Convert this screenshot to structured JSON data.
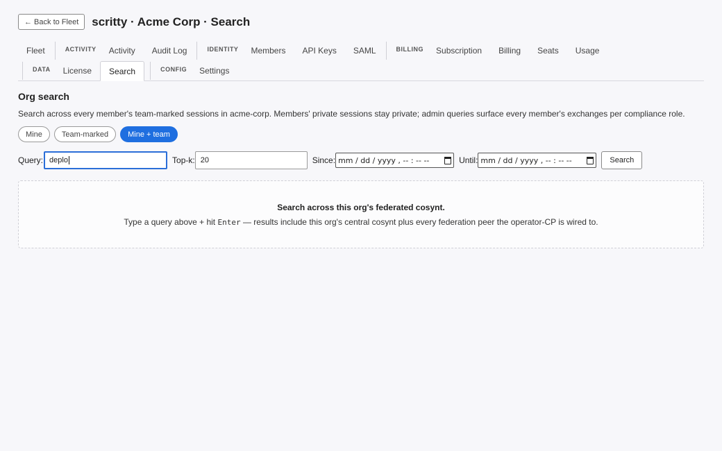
{
  "header": {
    "back_label": "← Back to Fleet",
    "title": "scritty · Acme Corp · Search"
  },
  "nav": {
    "row1": {
      "fleet": "Fleet",
      "activity_group": "ACTIVITY",
      "activity": "Activity",
      "audit_log": "Audit Log",
      "identity_group": "IDENTITY",
      "members": "Members",
      "api_keys": "API Keys",
      "saml": "SAML",
      "billing_group": "BILLING",
      "subscription": "Subscription",
      "billing": "Billing",
      "seats": "Seats",
      "usage": "Usage"
    },
    "row2": {
      "data_group": "DATA",
      "license": "License",
      "search": "Search",
      "config_group": "CONFIG",
      "settings": "Settings"
    },
    "active_tab": "Search"
  },
  "section": {
    "title": "Org search",
    "description": "Search across every member's team-marked sessions in acme-corp. Members' private sessions stay private; admin queries surface every member's exchanges per compliance role."
  },
  "scope": {
    "options": [
      "Mine",
      "Team-marked",
      "Mine + team"
    ],
    "selected": "Mine + team"
  },
  "query_form": {
    "query_label": "Query:",
    "query_value": "deplo",
    "topk_label": "Top-k:",
    "topk_value": "20",
    "since_label": "Since:",
    "since_value": "mm / dd / yyyy ,  -- : --  --",
    "until_label": "Until:",
    "until_value": "mm / dd / yyyy ,  -- : --  --",
    "search_label": "Search"
  },
  "empty_state": {
    "title": "Search across this org's federated cosynt.",
    "desc_before": "Type a query above + hit ",
    "desc_key": "Enter",
    "desc_after": " — results include this org's central cosynt plus every federation peer the operator-CP is wired to."
  },
  "colors": {
    "accent": "#1f6fe0",
    "focus_ring": "#2b6ed8",
    "background": "#f7f7fa"
  }
}
